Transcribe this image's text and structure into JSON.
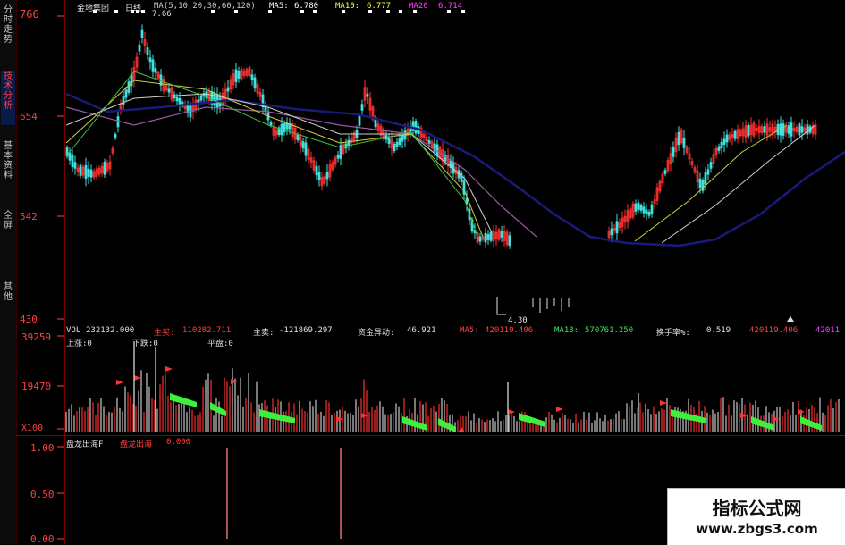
{
  "side_tabs": [
    {
      "label": "分时走势",
      "active": false
    },
    {
      "label": "技术分析",
      "active": true
    },
    {
      "label": "基本资料",
      "active": false
    },
    {
      "label": "全屏",
      "active": false
    },
    {
      "label": "其他",
      "active": false
    }
  ],
  "price_panel": {
    "stock_name": "金地集团",
    "period": "日线",
    "ma_params": "MA(5,10,20,30,60,120)",
    "ma5_label": "MA5:",
    "ma5_value": "6.780",
    "ma10_label": "MA10:",
    "ma10_value": "6.777",
    "ma20_label": "MA20",
    "ma20_value": "6.714",
    "axis": {
      "top": "766",
      "upper": "654",
      "lower": "542",
      "bottom": "430"
    },
    "high_marker": "7.66",
    "low_marker": "4.30"
  },
  "volume_panel": {
    "vol_label": "VOL",
    "vol_value": "232132.000",
    "main_buy_label": "主买:",
    "main_buy_value": "110282.711",
    "main_sell_label": "主卖:",
    "main_sell_value": "-121869.297",
    "fund_flow_label": "资金异动:",
    "fund_flow_value": "46.921",
    "ma5_label": "MA5:",
    "ma5_value": "420119.406",
    "ma13_label": "MA13:",
    "ma13_value": "570761.250",
    "turnover_label": "换手率%:",
    "turnover_value": "0.519",
    "tail_value_1": "420119.406",
    "tail_value_2": "42011",
    "up_label": "上涨:0",
    "down_label": "下跌:0",
    "flat_label": "平盘:0",
    "axis": {
      "top": "39259",
      "mid": "19470",
      "unit": "X100"
    }
  },
  "indicator_panel": {
    "name": "盘龙出海F",
    "series_label": "盘龙出海",
    "series_value": "0.000",
    "axis": {
      "top": "1.00",
      "mid": "0.50",
      "bottom": "0.00"
    }
  },
  "watermark": {
    "title": "指标公式网",
    "url": "www.zbgs3.com"
  },
  "colors": {
    "axis_red": "#ff4040",
    "divider": "#8a0000",
    "candle_up": "#ff3030",
    "candle_down": "#40e0e0",
    "vol_green": "#3cf03c",
    "ma_blue": "#1a1a7a"
  }
}
